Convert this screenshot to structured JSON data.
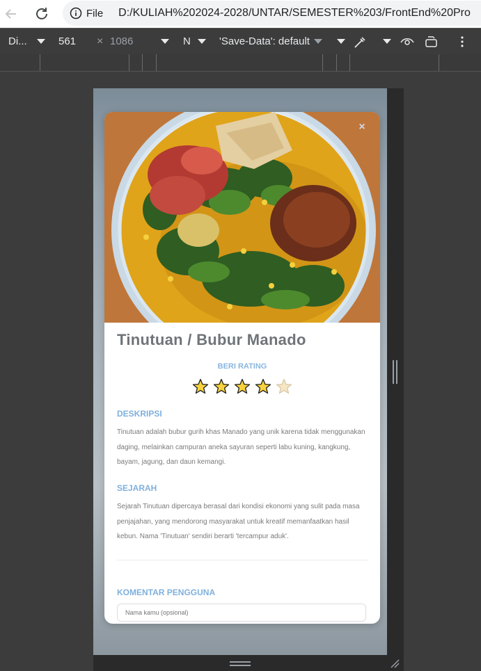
{
  "browser": {
    "file_label": "File",
    "url": "D:/KULIAH%202024-2028/UNTAR/SEMESTER%203/FrontEnd%20Pro"
  },
  "devtools": {
    "device_label": "Di...",
    "width_value": "561",
    "height_value": "1086",
    "times": "×",
    "throttle_label": "N",
    "save_data_label": "'Save-Data': default"
  },
  "modal": {
    "close_label": "×",
    "title": "Tinutuan / Bubur Manado",
    "rating_label": "BERI RATING",
    "rating": {
      "value": 4,
      "max": 5
    },
    "description_title": "DESKRIPSI",
    "description_text": "Tinutuan adalah bubur gurih khas Manado yang unik karena tidak menggunakan daging, melainkan campuran aneka sayuran seperti labu kuning, kangkung, bayam, jagung, dan daun kemangi.",
    "history_title": "SEJARAH",
    "history_text": "Sejarah Tinutuan dipercaya berasal dari kondisi ekonomi yang sulit pada masa penjajahan, yang mendorong masyarakat untuk kreatif memanfaatkan hasil kebun. Nama 'Tinutuan' sendiri berarti 'tercampur aduk'.",
    "comments_title": "KOMENTAR PENGGUNA",
    "name_placeholder": "Nama kamu (opsional)"
  },
  "colors": {
    "accent": "#7fb0dd",
    "title": "#6f7479",
    "star_filled": "#f7d23e",
    "star_empty": "#f5e6c4"
  }
}
